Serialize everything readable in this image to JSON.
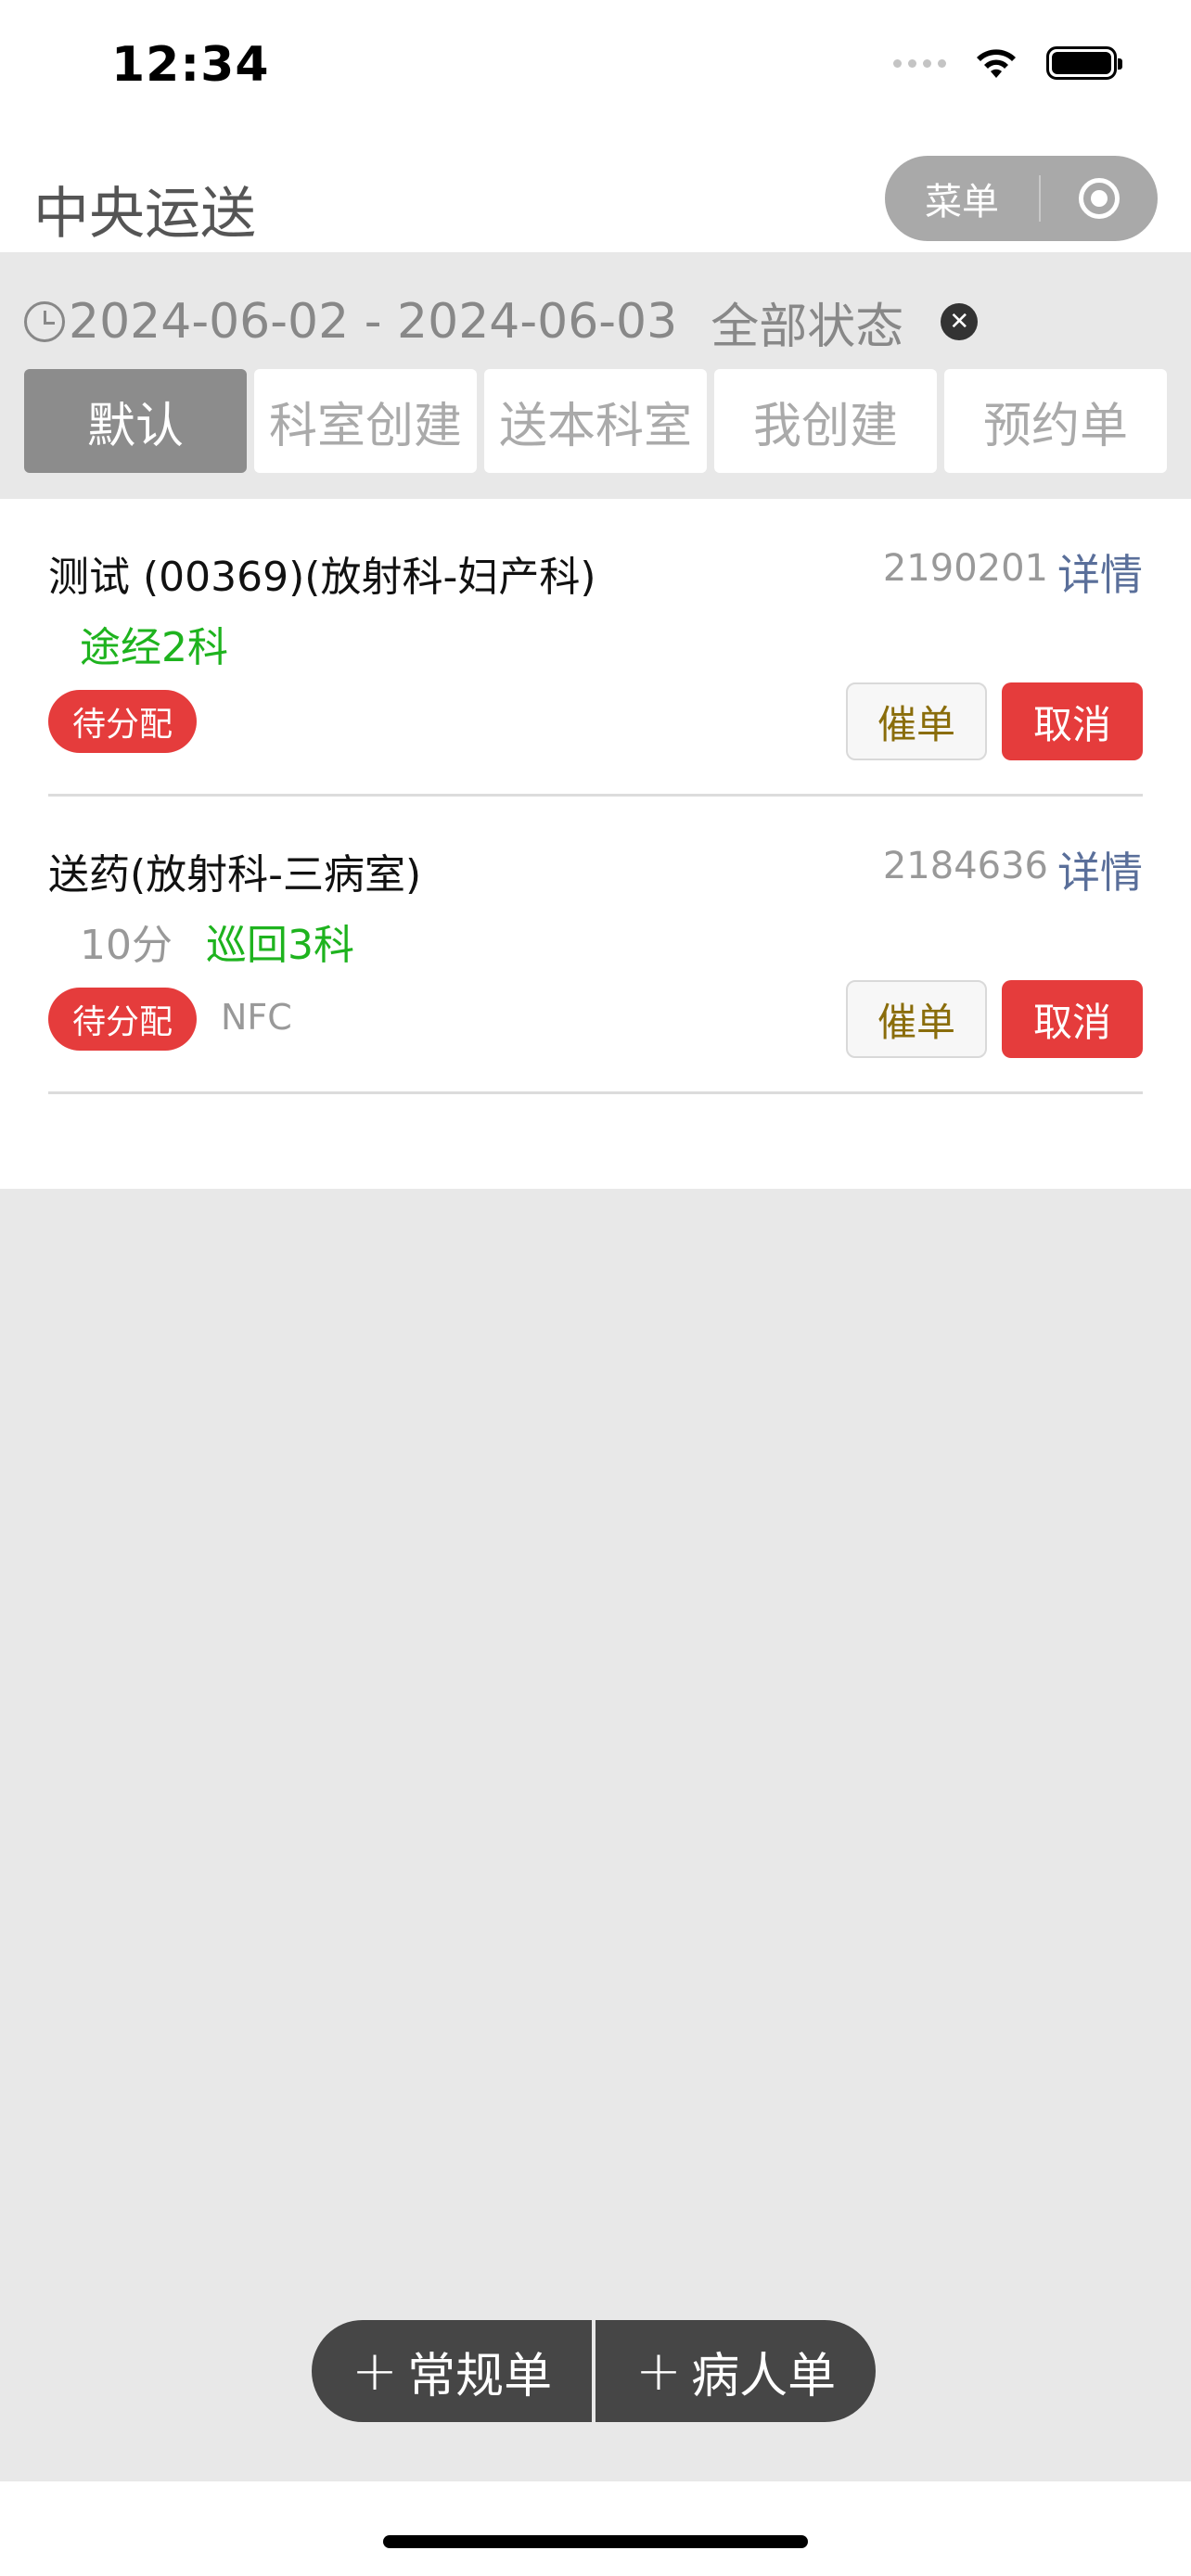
{
  "status_bar": {
    "time": "12:34"
  },
  "nav": {
    "title": "中央运送",
    "menu_label": "菜单"
  },
  "filter": {
    "date_range": "2024-06-02 - 2024-06-03",
    "status": "全部状态",
    "clear_symbol": "✕",
    "tabs": [
      {
        "label": "默认",
        "active": true
      },
      {
        "label": "科室创建",
        "active": false
      },
      {
        "label": "送本科室",
        "active": false
      },
      {
        "label": "我创建",
        "active": false
      },
      {
        "label": "预约单",
        "active": false
      }
    ]
  },
  "orders": [
    {
      "title": "测试 (00369)(放射科-妇产科)",
      "id": "2190201",
      "detail_label": "详情",
      "time": "",
      "route": "途经2科",
      "badge": "待分配",
      "tag": "",
      "urge_label": "催单",
      "cancel_label": "取消"
    },
    {
      "title": "送药(放射科-三病室)",
      "id": "2184636",
      "detail_label": "详情",
      "time": "10分",
      "route": "巡回3科",
      "badge": "待分配",
      "tag": "NFC",
      "urge_label": "催单",
      "cancel_label": "取消"
    }
  ],
  "actions": {
    "regular_order": "常规单",
    "patient_order": "病人单",
    "plus": "+"
  },
  "colors": {
    "danger": "#e53c3c",
    "route_green": "#1eb31e",
    "link_blue": "#5a6f9a",
    "fab_bg": "#464646"
  }
}
